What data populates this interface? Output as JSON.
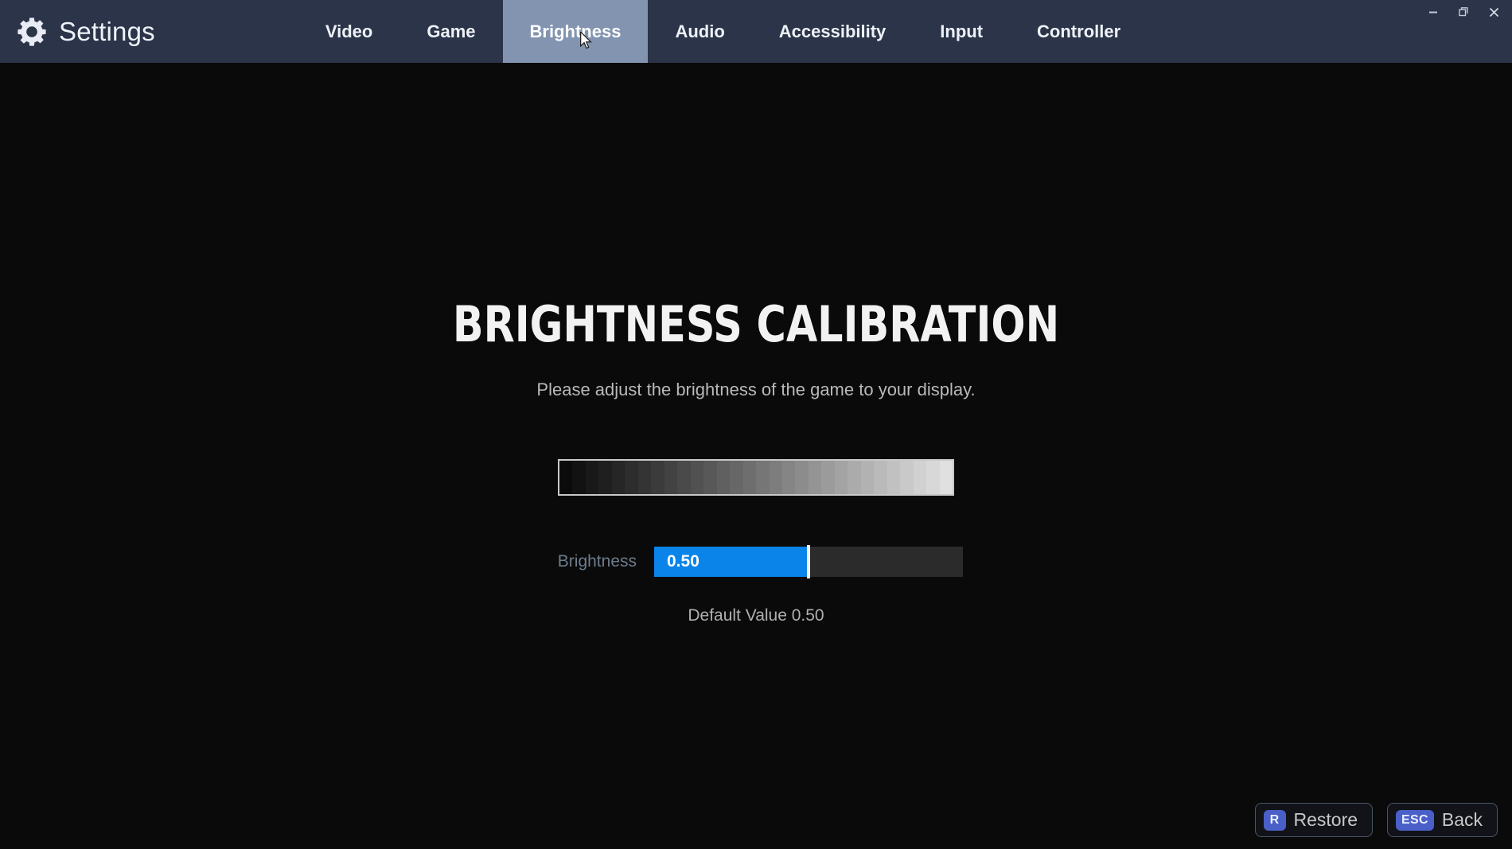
{
  "window": {
    "brand_title": "Settings",
    "brand_icon": "gear-icon",
    "controls": {
      "minimize": "minimize-icon",
      "restore": "restore-icon",
      "close": "close-icon"
    },
    "header_bg": "#2b3448",
    "active_tab_bg": "#8294b0"
  },
  "nav": {
    "tabs": [
      {
        "label": "Video",
        "active": false
      },
      {
        "label": "Game",
        "active": false
      },
      {
        "label": "Brightness",
        "active": true
      },
      {
        "label": "Audio",
        "active": false
      },
      {
        "label": "Accessibility",
        "active": false
      },
      {
        "label": "Input",
        "active": false
      },
      {
        "label": "Controller",
        "active": false
      }
    ]
  },
  "main": {
    "title": "BRIGHTNESS CALIBRATION",
    "subtitle": "Please adjust the brightness of the game to your display.",
    "default_value_text": "Default Value 0.50",
    "gradient": {
      "steps": [
        "#0b0b0b",
        "#121212",
        "#191919",
        "#1f1f1f",
        "#262626",
        "#2d2d2d",
        "#343434",
        "#3b3b3b",
        "#434343",
        "#4a4a4a",
        "#515151",
        "#585858",
        "#606060",
        "#676767",
        "#6e6e6e",
        "#767676",
        "#7d7d7d",
        "#858585",
        "#8c8c8c",
        "#949494",
        "#9b9b9b",
        "#a3a3a3",
        "#ababab",
        "#b2b2b2",
        "#bababa",
        "#c1c1c1",
        "#c9c9c9",
        "#d1d1d1",
        "#d8d8d8",
        "#e0e0e0"
      ],
      "border_color": "#c9c9c9"
    },
    "slider": {
      "label": "Brightness",
      "value_text": "0.50",
      "value": 0.5,
      "min": 0,
      "max": 1,
      "fill_percent": 50,
      "fill_color": "#0a84e8",
      "track_color": "#2b2b2b",
      "handle_color": "#f2f2f2"
    }
  },
  "footer": {
    "actions": [
      {
        "key": "R",
        "label": "Restore"
      },
      {
        "key": "ESC",
        "label": "Back"
      }
    ],
    "key_badge_color": "#4a5fc8"
  }
}
